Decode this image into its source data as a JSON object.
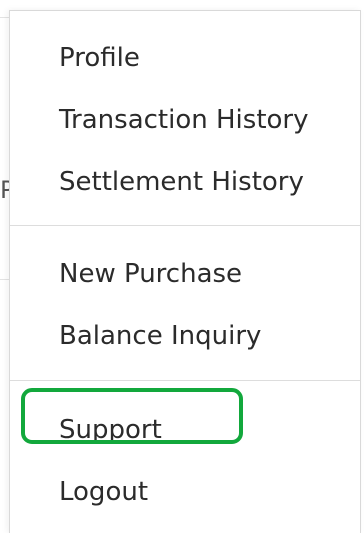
{
  "menu": {
    "items": [
      {
        "label": "Profile"
      },
      {
        "label": "Transaction History"
      },
      {
        "label": "Settlement History"
      },
      {
        "label": "New Purchase"
      },
      {
        "label": "Balance Inquiry"
      },
      {
        "label": "Support"
      },
      {
        "label": "Logout"
      }
    ]
  },
  "highlight": {
    "item": "Support",
    "color": "#12a83c"
  },
  "colors": {
    "text": "#2b2b2b",
    "divider": "#dddddd",
    "border": "#d9d9d9"
  }
}
